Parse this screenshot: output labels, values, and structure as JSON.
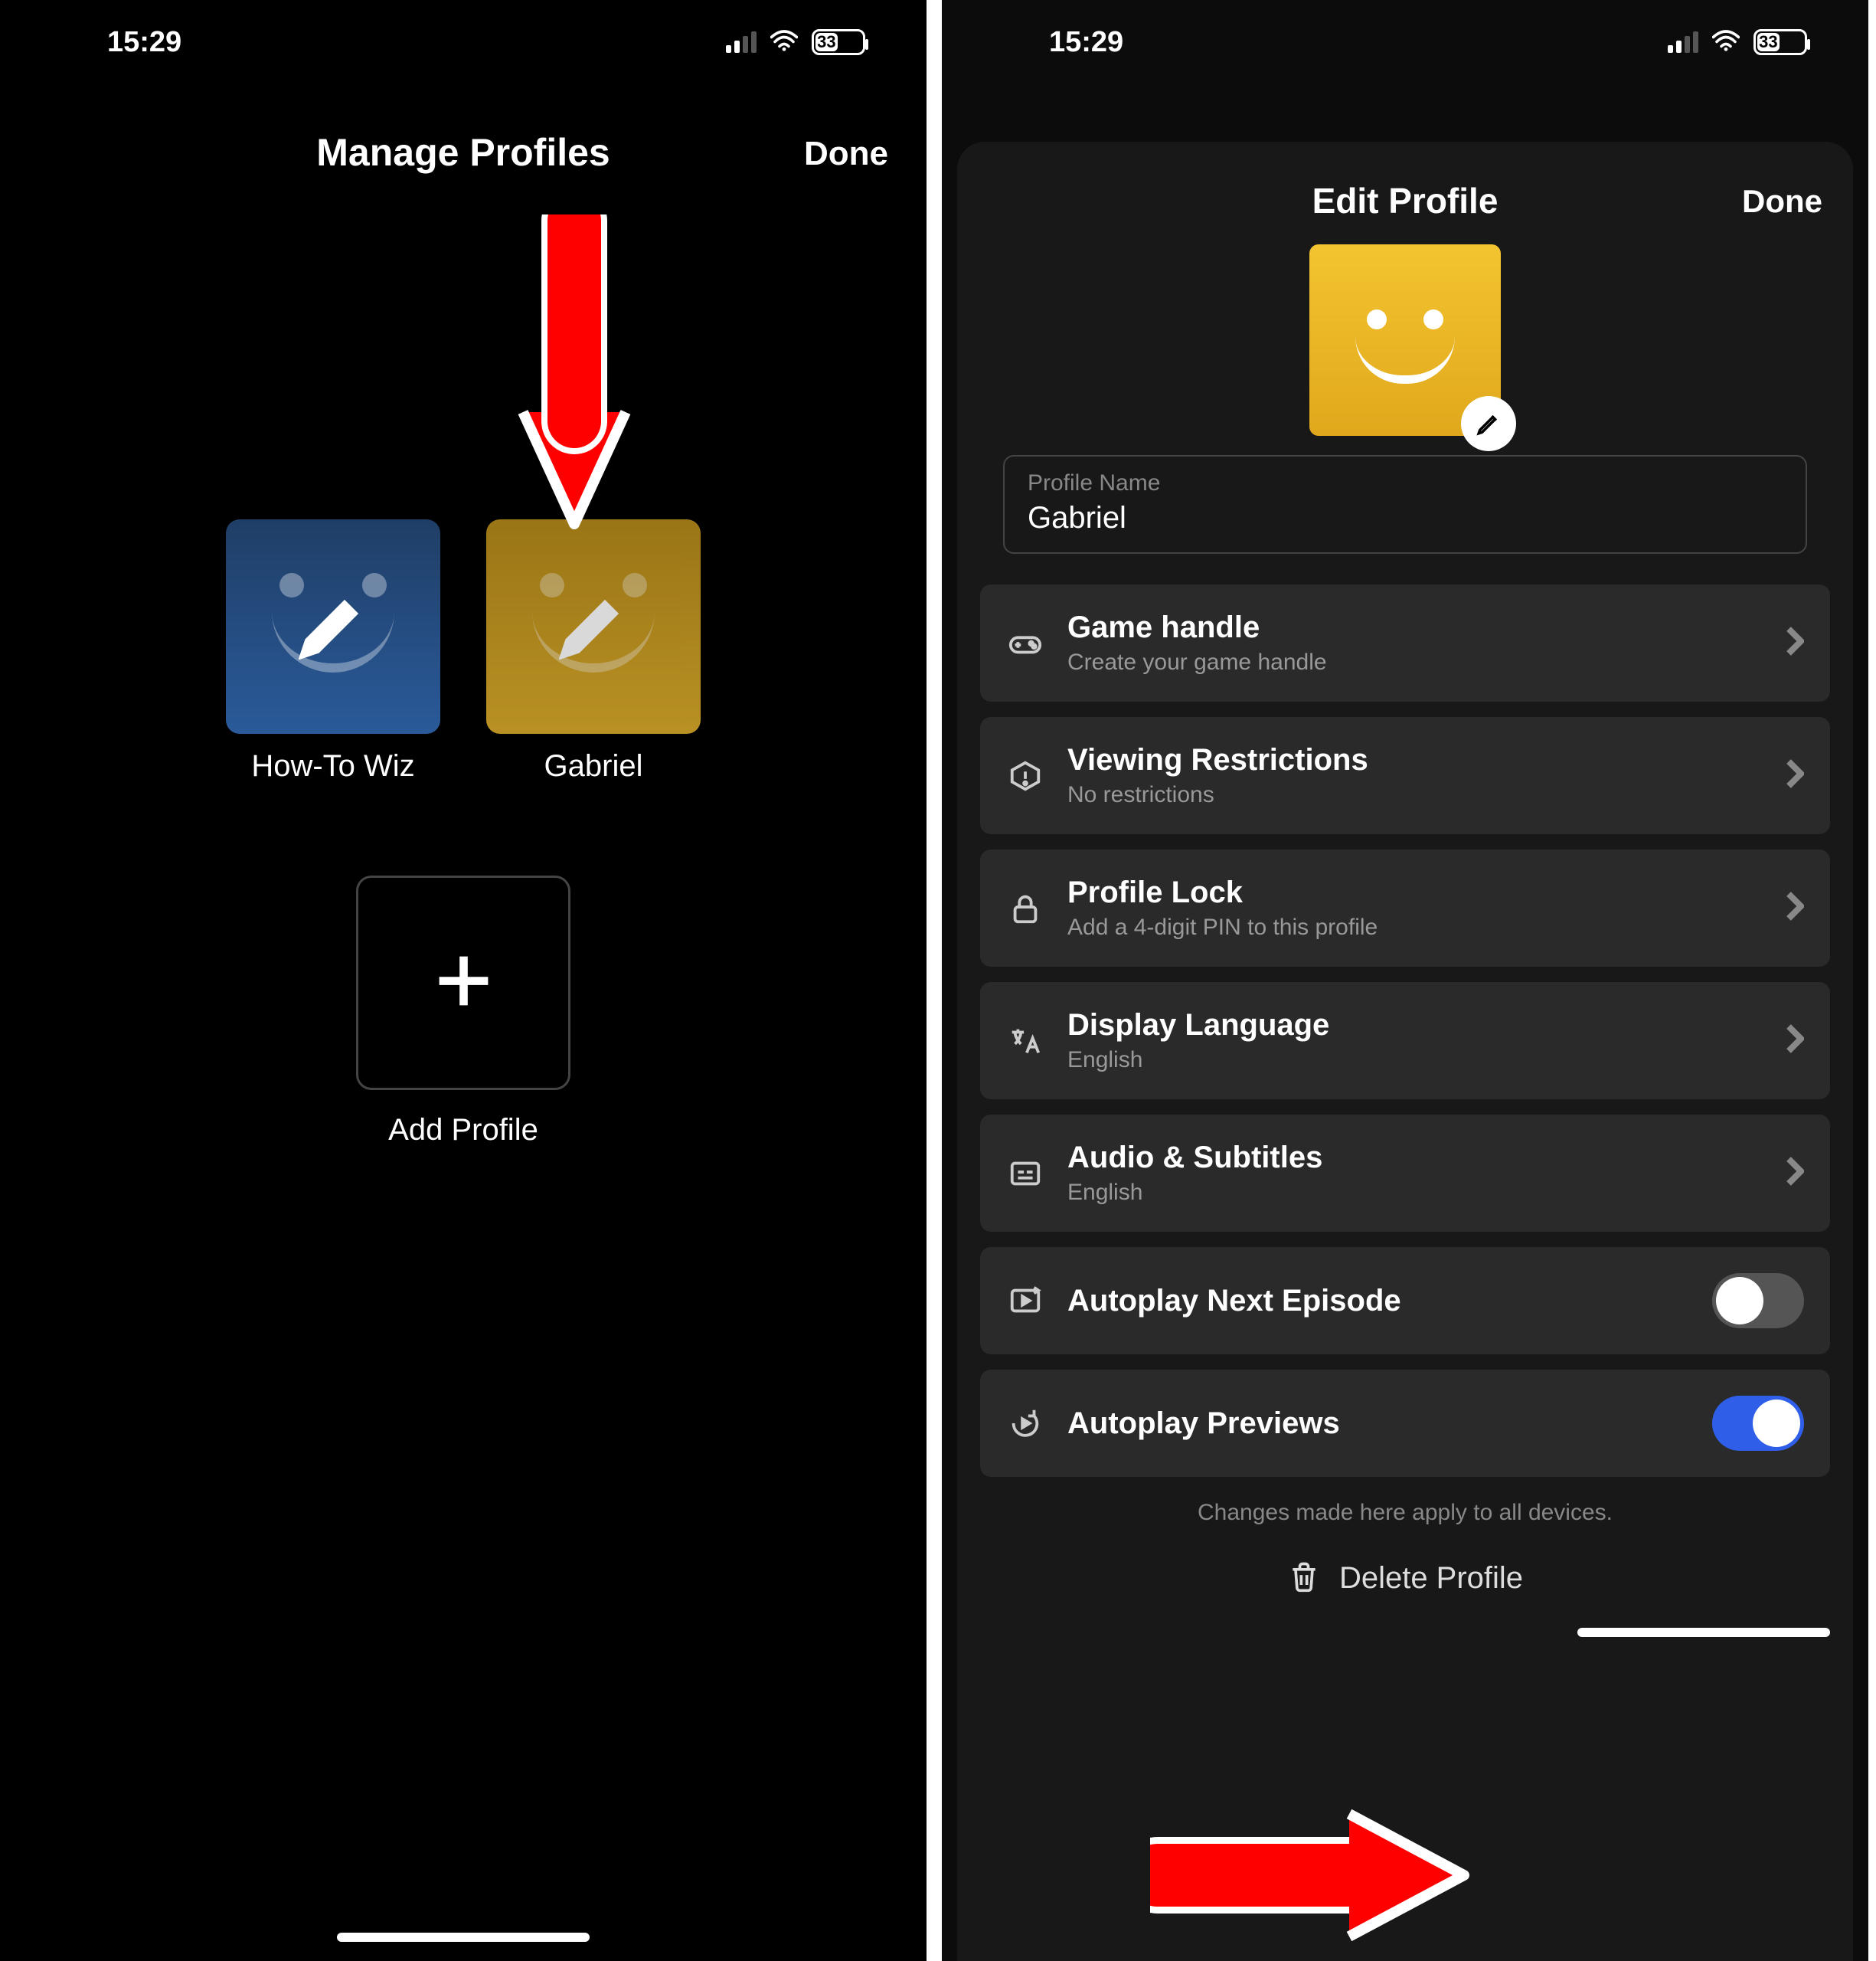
{
  "status": {
    "time": "15:29",
    "battery": "33",
    "battery_width_pct": 48
  },
  "left": {
    "title": "Manage Profiles",
    "done": "Done",
    "profiles": [
      {
        "name": "How-To Wiz"
      },
      {
        "name": "Gabriel"
      }
    ],
    "add_label": "Add Profile"
  },
  "right": {
    "title": "Edit Profile",
    "done": "Done",
    "name_label": "Profile Name",
    "name_value": "Gabriel",
    "rows": [
      {
        "title": "Game handle",
        "sub": "Create your game handle"
      },
      {
        "title": "Viewing Restrictions",
        "sub": "No restrictions"
      },
      {
        "title": "Profile Lock",
        "sub": "Add a 4-digit PIN to this profile"
      },
      {
        "title": "Display Language",
        "sub": "English"
      },
      {
        "title": "Audio & Subtitles",
        "sub": "English"
      }
    ],
    "autoplay_next": "Autoplay Next Episode",
    "autoplay_previews": "Autoplay Previews",
    "footer": "Changes made here apply to all devices.",
    "delete": "Delete Profile"
  }
}
